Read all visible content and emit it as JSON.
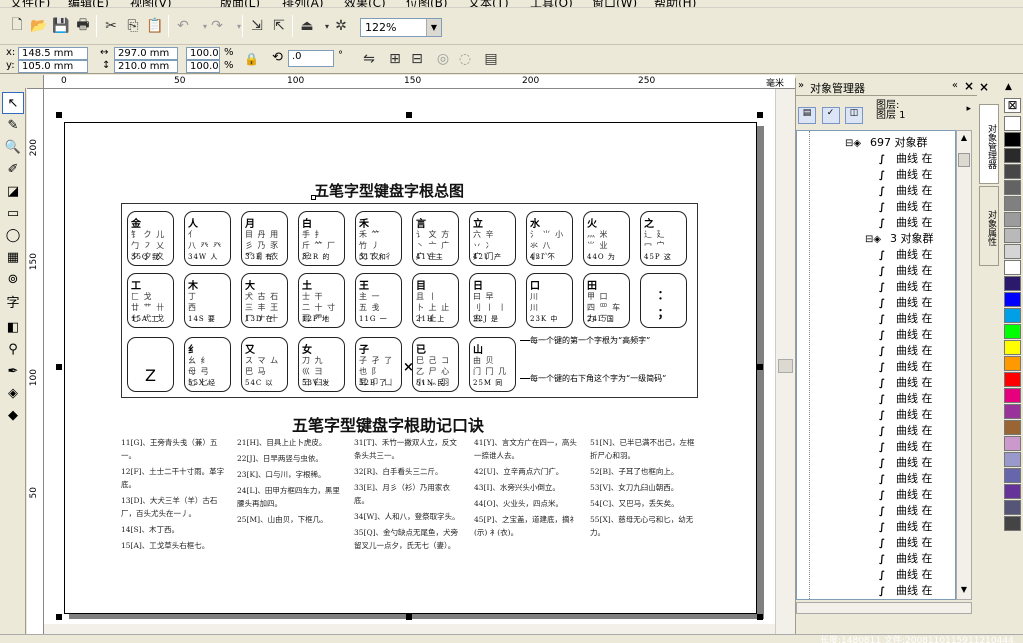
{
  "menu": [
    "文件(F)",
    "编辑(E)",
    "视图(V)",
    "版面(L)",
    "排列(A)",
    "效果(C)",
    "位图(B)",
    "文本(T)",
    "工具(O)",
    "窗口(W)",
    "帮助(H)"
  ],
  "toolbar": {
    "zoom": "122%"
  },
  "property_bar": {
    "x": "148.5 mm",
    "y": "105.0 mm",
    "width": "297.0 mm",
    "height": "210.0 mm",
    "scale_x": "100.0",
    "scale_y": "100.0",
    "percent": "%",
    "rotation": ".0",
    "degree": "°",
    "x_label": "x:",
    "y_label": "y:"
  },
  "ruler": {
    "unit": "毫米",
    "h_ticks": [
      "0",
      "50",
      "100",
      "150",
      "200",
      "250"
    ],
    "v_ticks": [
      "200",
      "150",
      "100",
      "50"
    ]
  },
  "document": {
    "title1": "五笔字型键盘字根总图",
    "title2": "五笔字型键盘字根助记口诀",
    "note1": "每一个键的第一个字根为“高频字”",
    "note2": "每一个键的右下角这个字为“一级简码”",
    "keys_row1": [
      {
        "name": "金",
        "roots": "钅 ク 儿\n勹 ㇇ 乂\n夕 夕 夊",
        "code": "35Q 我"
      },
      {
        "name": "人",
        "roots": "亻\n八 癶 癶",
        "code": "34W 人"
      },
      {
        "name": "月",
        "roots": "目 丹 用\n彡 乃 豕\n爫 ⺼ 衣",
        "code": "33E 有"
      },
      {
        "name": "白",
        "roots": "手 扌\n斤 ⺮ 厂\n斤",
        "code": "32R 的"
      },
      {
        "name": "禾",
        "roots": "禾 ⺮\n竹 丿\n攵 夂 彳",
        "code": "31T 和"
      },
      {
        "name": "言",
        "roots": "讠 文 方\n丶 亠 广\n广 主",
        "code": "41Y 主"
      },
      {
        "name": "立",
        "roots": "六 辛\n丷 冫\n疒 门",
        "code": "42U 产"
      },
      {
        "name": "水",
        "roots": "氵 ⺌ 小\n氺 八\n小 ⺍",
        "code": "43I 不"
      },
      {
        "name": "火",
        "roots": "灬 米\n⺌ 业",
        "code": "44O 为"
      },
      {
        "name": "之",
        "roots": "辶 廴\n冖 宀",
        "code": "45P 这"
      }
    ],
    "keys_row2": [
      {
        "name": "工",
        "roots": "匚 戈\n廿 艹 卄\n七 弋 戈",
        "code": "15A 工"
      },
      {
        "name": "木",
        "roots": "丁\n西",
        "code": "14S 要"
      },
      {
        "name": "大",
        "roots": "犬 古 石\n三 丰 王\n厂 ナ 十",
        "code": "13D 在"
      },
      {
        "name": "土",
        "roots": "士 干\n二 十 寸\n雨 ⻗",
        "code": "12F 地"
      },
      {
        "name": "王",
        "roots": "主 一\n五 戋",
        "code": "11G 一"
      },
      {
        "name": "目",
        "roots": "且 丨\n卜 上 止\n⺊ 止",
        "code": "21H 上"
      },
      {
        "name": "日",
        "roots": "曰 早\n刂 丨 丨\n虫",
        "code": "22J 是"
      },
      {
        "name": "口",
        "roots": "川\n川",
        "code": "23K 中"
      },
      {
        "name": "田",
        "roots": "甲 口\n四 罒 车\n力 ㄎ",
        "code": "24L 国"
      },
      {
        "name": "",
        "roots": "",
        "code": "",
        "symbol": "：\n；"
      }
    ],
    "keys_row3": [
      {
        "name": "",
        "roots": "",
        "code": "",
        "symbol": "Z"
      },
      {
        "name": "纟",
        "roots": "幺 纟\n母 弓\n匕 匕",
        "code": "55X 经"
      },
      {
        "name": "又",
        "roots": "ス マ ム\n巴 马",
        "code": "54C 以"
      },
      {
        "name": "女",
        "roots": "刀 九\n巛 ⺕\n彐 臼",
        "code": "53V 发"
      },
      {
        "name": "子",
        "roots": "子 孑 了\n也 ⻖\n耳 卩 凵",
        "code": "52B 了"
      },
      {
        "name": "已",
        "roots": "巳 己 コ\n乙 尸 心\n小 ⺗ 羽",
        "code": "51N 民"
      },
      {
        "name": "山",
        "roots": "由 贝\n门 冂 几",
        "code": "25M 同"
      }
    ],
    "mnemonics": [
      [
        "11[G]、王旁青头戋（兼）五一。",
        "12[F]、土士二干十寸雨。革字底。",
        "13[D]、大犬三羊（羊）古石厂，百头尤头在一丿。",
        "14[S]、木丁西。",
        "15[A]、工戈草头右框七。"
      ],
      [
        "21[H]、目具上止卜虎皮。",
        "22[J]、日早两竖与虫依。",
        "23[K]、口与川，字根稀。",
        "24[L]、田甲方框四车力，黑里腰头再加四。",
        "25[M]、山由贝，下框几。"
      ],
      [
        "31[T]、禾竹一撇双人立，反文条头共三一。",
        "32[R]、白手看头三二斤。",
        "33[E]、月彡（衫）乃用家衣底。",
        "34[W]、人和八，登祭取字头。",
        "35[Q]、金勺缺点无尾鱼，犬旁留叉儿一点夕，氏无七（妻）。"
      ],
      [
        "41[Y]、言文方广在四一，高头一捺谁人去。",
        "42[U]、立辛两点六门疒。",
        "43[I]、水旁兴头小倒立。",
        "44[O]、火业头，四点米。",
        "45[P]、之宝盖，道建底，摘礻(示) 衤(衣)。"
      ],
      [
        "51[N]、已半已满不出己，左框折尸心和羽。",
        "52[B]、子耳了也框向上。",
        "53[V]、女刀九臼山朝西。",
        "54[C]、又巴马，丢矢矣。",
        "55[X]、慈母无心弓和匕，幼无力。"
      ]
    ]
  },
  "docker": {
    "title": "对象管理器",
    "layer_line1": "图层:",
    "layer_line2": "图层 1",
    "group1": "697 对象群",
    "group2": "3 对象群",
    "item": "曲线 在"
  },
  "side_tabs": [
    "对象管理器",
    "对象属性"
  ],
  "palette": [
    "#ffffff",
    "#000000",
    "#2a2a2a",
    "#474747",
    "#636363",
    "#808080",
    "#9c9c9c",
    "#b9b9b9",
    "#d5d5d5",
    "#ffffff",
    "#2b1a6b",
    "#0000ff",
    "#00a0e6",
    "#00ff00",
    "#ffff00",
    "#ff9900",
    "#ff0000",
    "#e6007e",
    "#993399",
    "#996633",
    "#cc99cc",
    "#9999cc",
    "#6666aa",
    "#663399",
    "#555577",
    "#444444"
  ],
  "status": "长度:1480811 文件:2008110115911210444"
}
